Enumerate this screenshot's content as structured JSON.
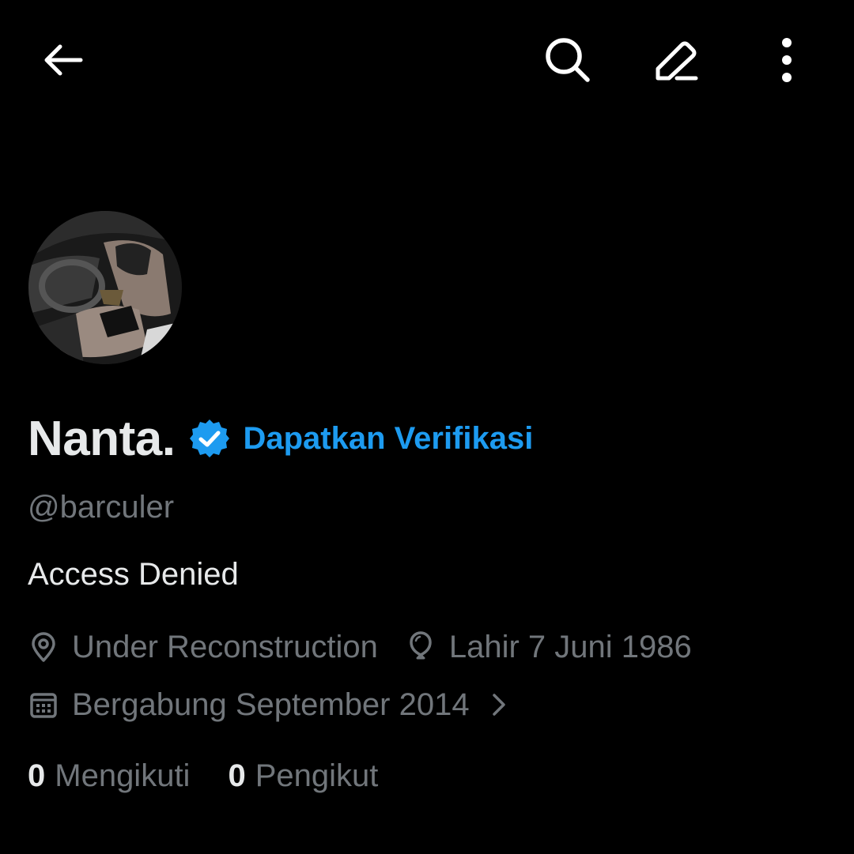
{
  "header": {
    "back_icon": "arrow-left-icon",
    "search_icon": "search-icon",
    "edit_icon": "pencil-icon",
    "more_icon": "more-vertical-icon"
  },
  "profile": {
    "display_name": "Nanta.",
    "verified_badge_icon": "verified-badge-icon",
    "get_verified_label": "Dapatkan Verifikasi",
    "handle": "@barculer",
    "bio": "Access Denied",
    "location": "Under Reconstruction",
    "birthday": "Lahir 7 Juni 1986",
    "joined": "Bergabung September 2014",
    "following_count": "0",
    "following_label": "Mengikuti",
    "followers_count": "0",
    "followers_label": "Pengikut"
  },
  "colors": {
    "background": "#000000",
    "primary_text": "#e7e9ea",
    "secondary_text": "#71767b",
    "accent": "#1d9bf0"
  }
}
